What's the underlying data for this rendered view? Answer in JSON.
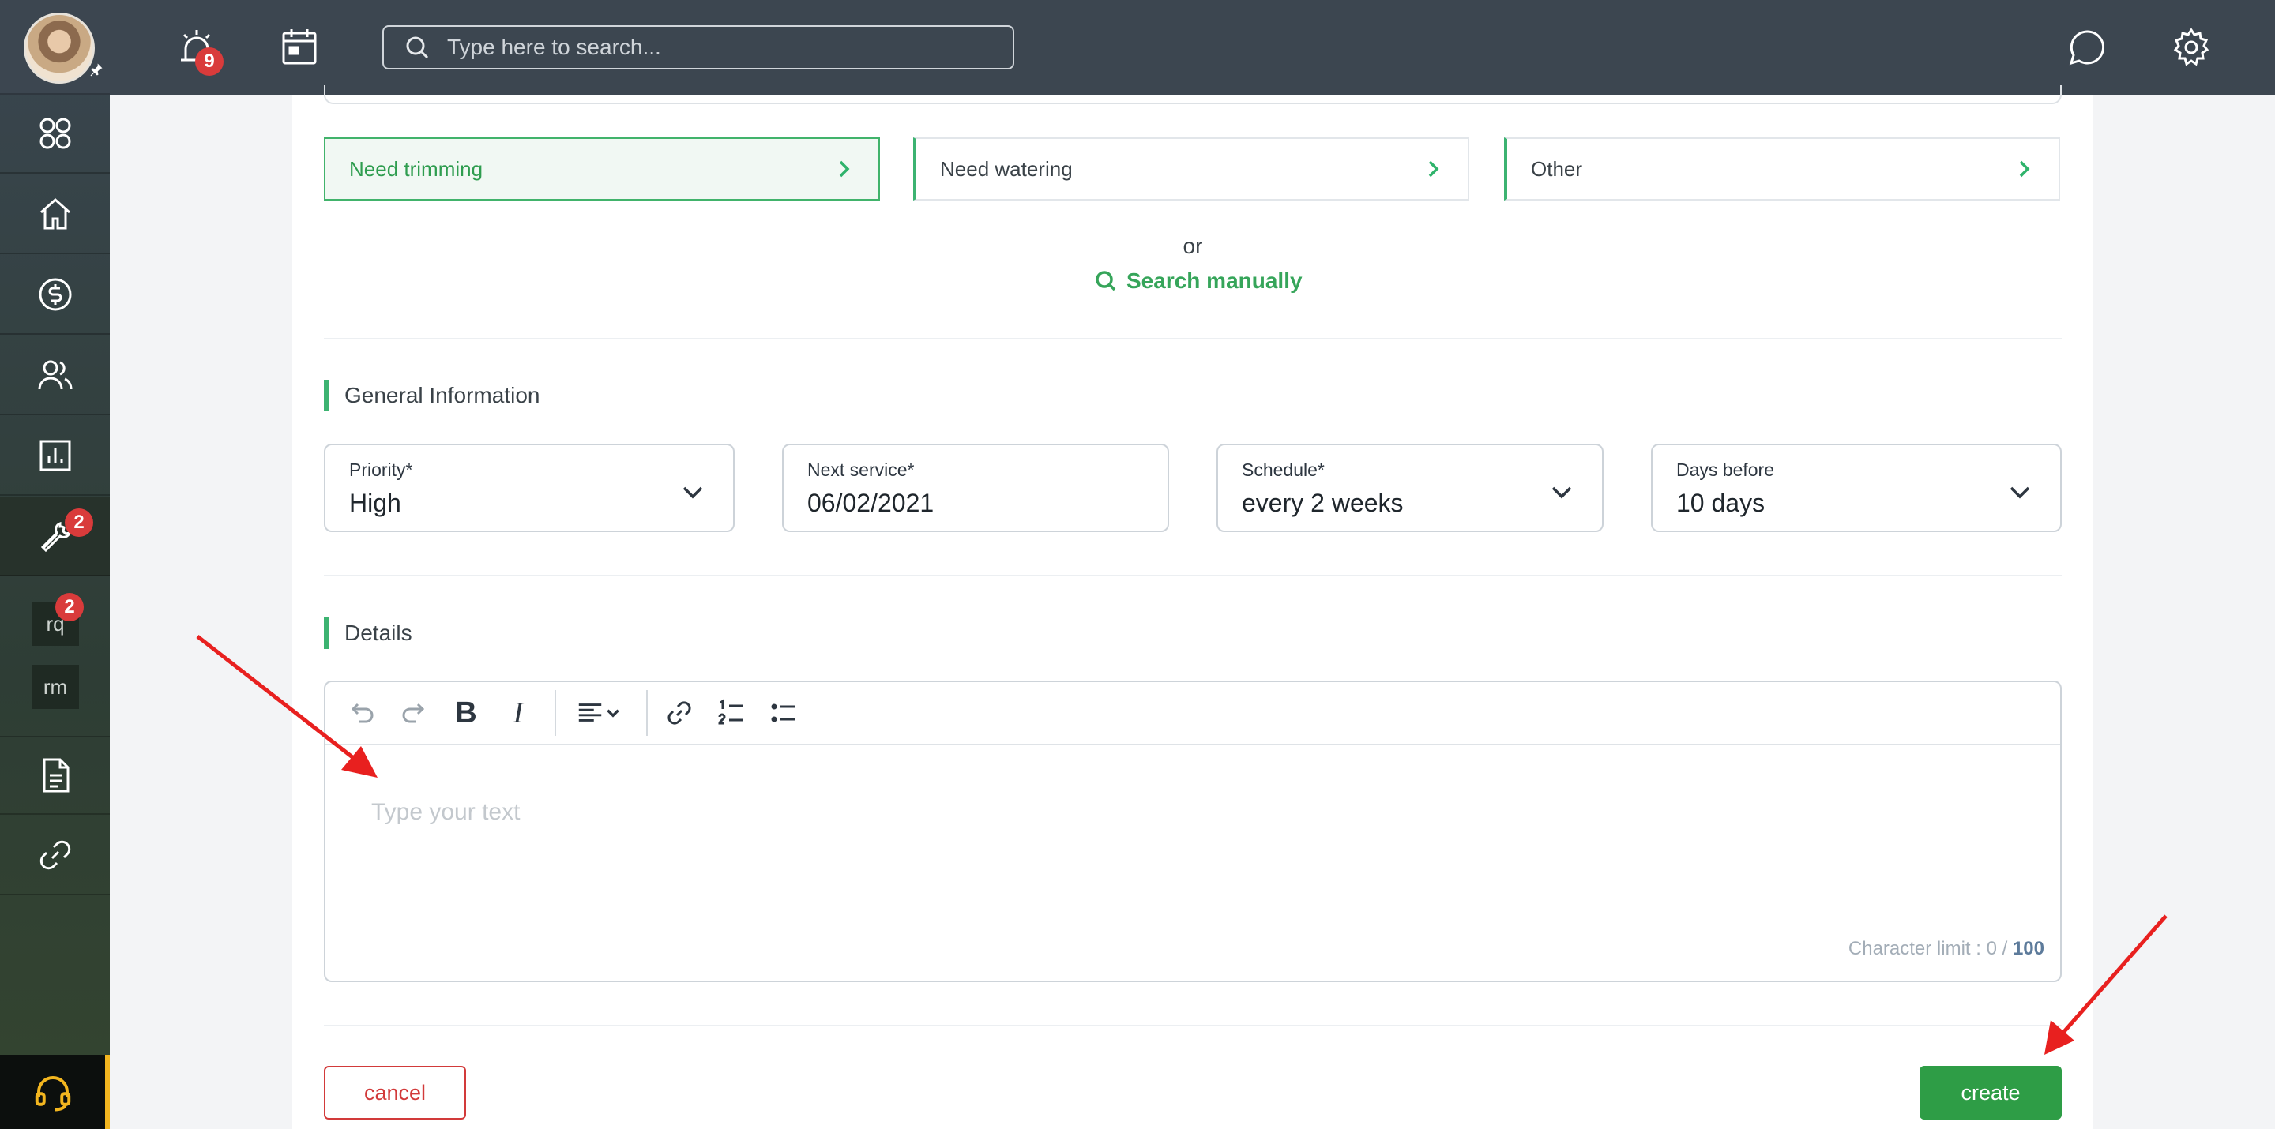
{
  "topbar": {
    "alarm_badge": "9",
    "search_placeholder": "Type here to search..."
  },
  "sidebar": {
    "tools_badge": "2",
    "mini_items": [
      {
        "label": "rq",
        "badge": "2"
      },
      {
        "label": "rm"
      }
    ]
  },
  "categories": [
    {
      "label": "Need trimming",
      "selected": true
    },
    {
      "label": "Need watering",
      "selected": false
    },
    {
      "label": "Other",
      "selected": false
    }
  ],
  "or_text": "or",
  "search_manually": "Search manually",
  "general": {
    "title": "General Information",
    "fields": [
      {
        "label": "Priority*",
        "value": "High"
      },
      {
        "label": "Next service*",
        "value": "06/02/2021"
      },
      {
        "label": "Schedule*",
        "value": "every 2 weeks"
      },
      {
        "label": "Days before",
        "value": "10 days"
      }
    ]
  },
  "details": {
    "title": "Details",
    "placeholder": "Type your text",
    "char_limit_label": "Character limit : 0 /",
    "char_limit_max": "100"
  },
  "actions": {
    "cancel": "cancel",
    "create": "create"
  },
  "colors": {
    "accent_green": "#2e9d46",
    "danger_red": "#d23a3a",
    "topbar": "#3c4650",
    "annotation_arrow": "#e8201f"
  }
}
